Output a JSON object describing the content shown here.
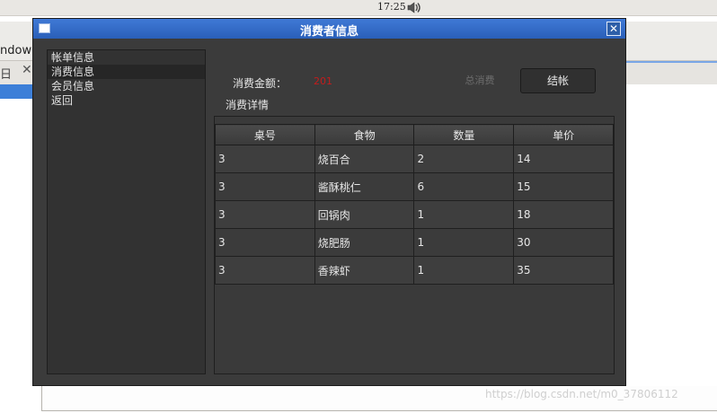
{
  "panel": {
    "clock": "17:25"
  },
  "background": {
    "menu_text": "ndow",
    "tab_text": "日",
    "watermark": "https://blog.csdn.net/m0_37806112"
  },
  "dialog": {
    "title": "消费者信息",
    "sidebar": [
      "帐单信息",
      "消费信息",
      "会员信息",
      "返回"
    ],
    "amount_label": "消费金额：",
    "amount_value": "201",
    "total_button": "总消费",
    "checkout_button": "结帐",
    "detail_label": "消费详情",
    "table": {
      "headers": [
        "桌号",
        "食物",
        "数量",
        "单价"
      ],
      "rows": [
        [
          "3",
          "烧百合",
          "2",
          "14"
        ],
        [
          "3",
          "酱酥桃仁",
          "6",
          "15"
        ],
        [
          "3",
          "回锅肉",
          "1",
          "18"
        ],
        [
          "3",
          "烧肥肠",
          "1",
          "30"
        ],
        [
          "3",
          "香辣虾",
          "1",
          "35"
        ]
      ]
    }
  },
  "colors": {
    "title_bar": "#2f66c4",
    "amount": "#c41c1c",
    "dialog_bg": "#3b3b3b"
  },
  "icons": {
    "volume": "speaker-icon",
    "close": "close-icon",
    "window": "window-icon"
  }
}
